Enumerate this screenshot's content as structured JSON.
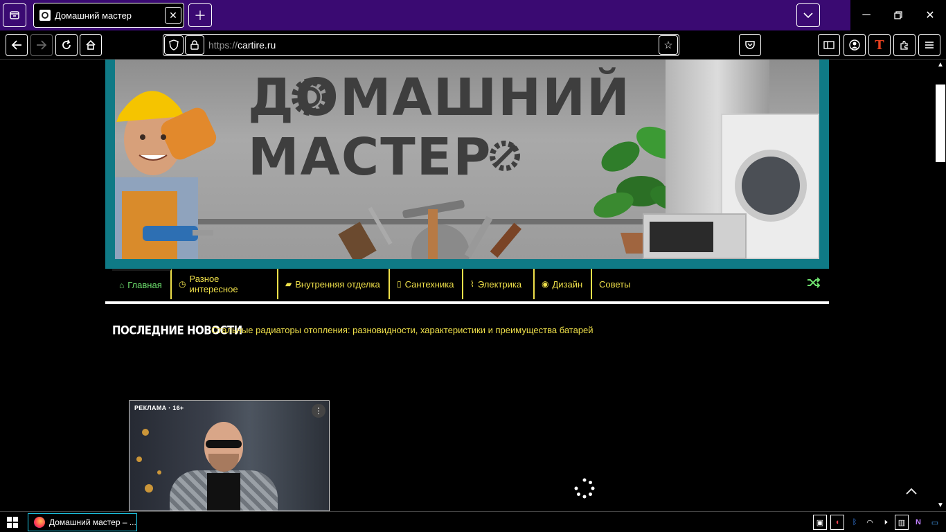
{
  "browser": {
    "tab_title": "Домашний мастер",
    "url_protocol": "https://",
    "url_host": "cartire.ru",
    "taskbar_title": "Домашний мастер – ..."
  },
  "banner": {
    "title_line1": "ДОМАШНИЙ",
    "title_line2": "МАСТЕР"
  },
  "menu": {
    "items": [
      {
        "label": "Главная",
        "icon": "home-icon"
      },
      {
        "label": "Разное интересное",
        "icon": "clock-icon"
      },
      {
        "label": "Внутренняя отделка",
        "icon": "briefcase-icon"
      },
      {
        "label": "Сантехника",
        "icon": "file-icon"
      },
      {
        "label": "Электрика",
        "icon": "chart-icon"
      },
      {
        "label": "Дизайн",
        "icon": "eye-icon"
      },
      {
        "label": "Советы",
        "icon": ""
      }
    ],
    "active_color": "#6ee06e",
    "item_color": "#f0e14a"
  },
  "news": {
    "label": "ПОСЛЕДНИЕ НОВОСТИ",
    "headline": "Стальные радиаторы отопления: разновидности, характеристики и преимущества батарей"
  },
  "ad": {
    "label": "РЕКЛАМА · 16+"
  },
  "colors": {
    "tabstrip": "#3a0a72",
    "banner_frame": "#0f7a86",
    "taskbar_accent": "#1ed0f0"
  }
}
